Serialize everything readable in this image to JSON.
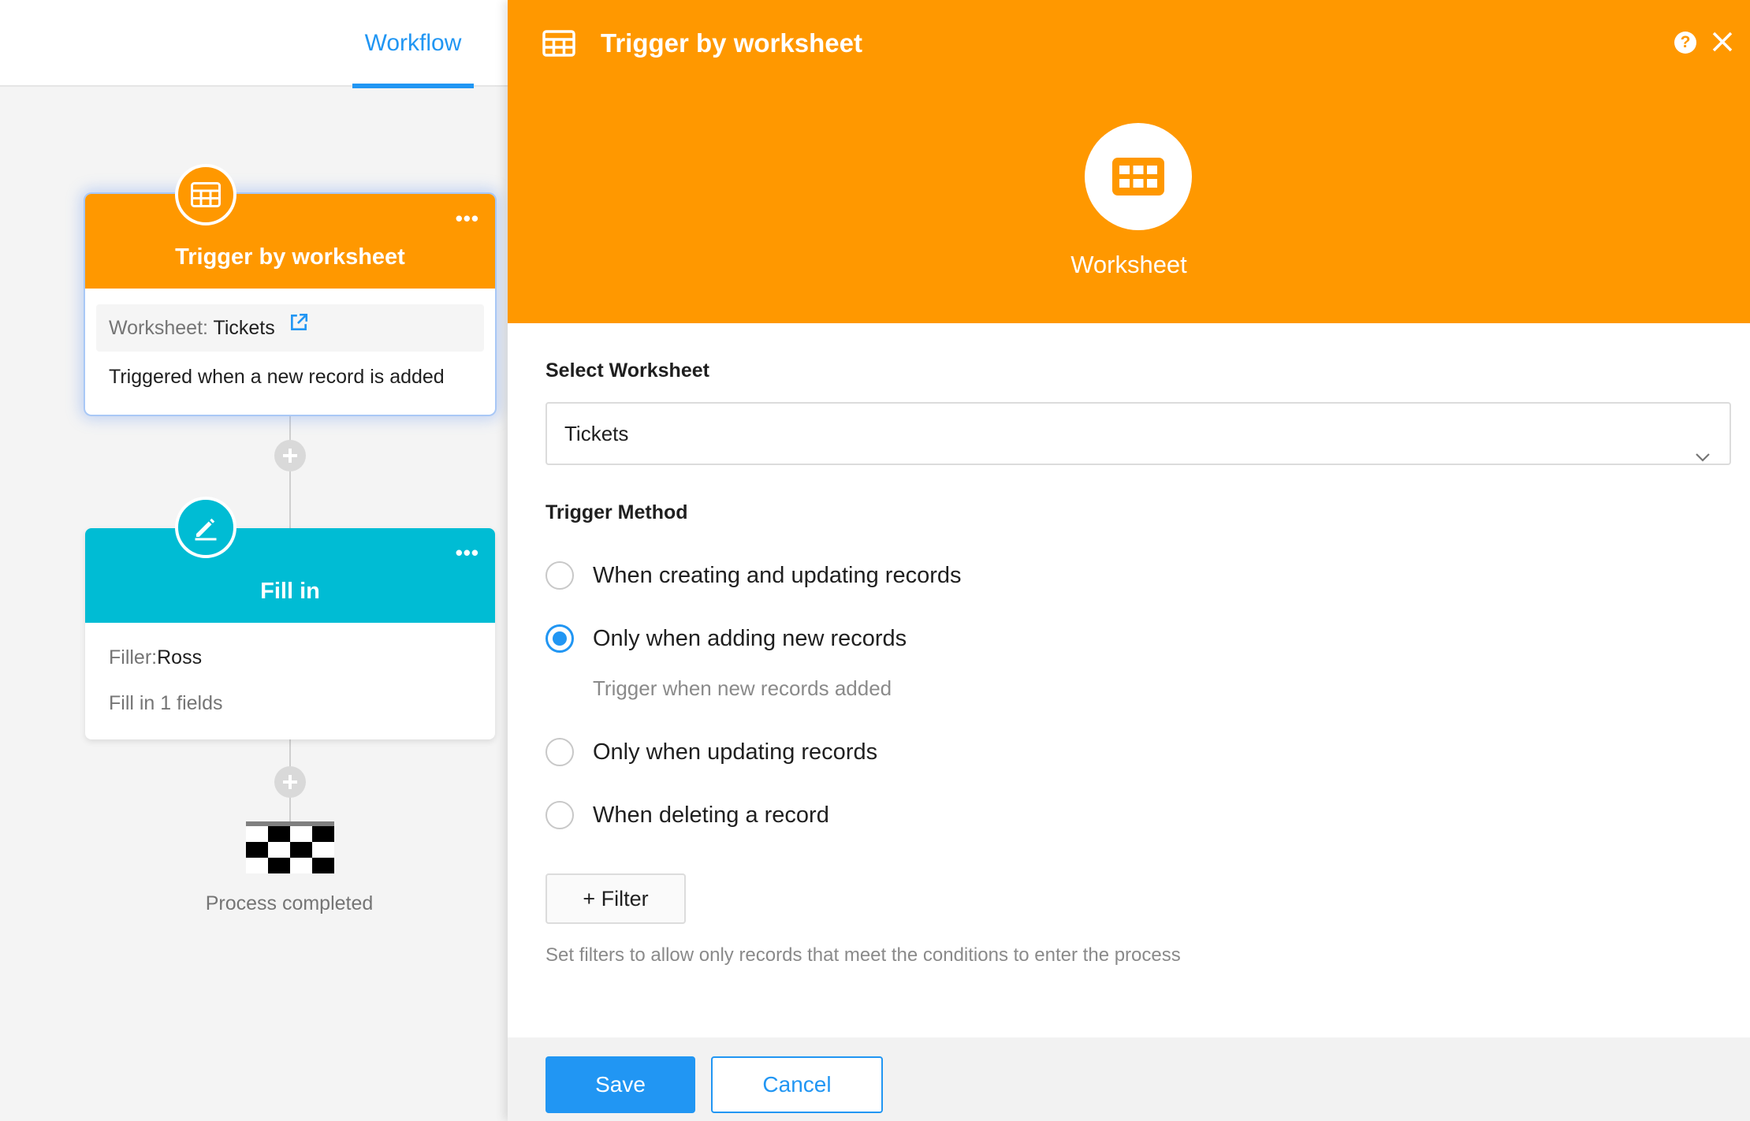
{
  "topbar": {
    "active_tab": "Workflow"
  },
  "flow": {
    "trigger_node": {
      "title": "Trigger by worksheet",
      "menu_icon": "ellipsis-icon",
      "worksheet_prefix": "Worksheet: ",
      "worksheet_value": "Tickets",
      "description": "Triggered when a new record is added",
      "color": "#ff9800"
    },
    "fill_node": {
      "title": "Fill in",
      "filler_prefix": "Filler:",
      "filler_value": "Ross",
      "fields_text": "Fill in 1 fields",
      "color": "#00bcd4"
    },
    "end": {
      "label": "Process completed"
    }
  },
  "panel": {
    "title": "Trigger by worksheet",
    "help_label": "?",
    "header_label": "Worksheet",
    "select_worksheet_label": "Select Worksheet",
    "select_worksheet_value": "Tickets",
    "trigger_method_label": "Trigger Method",
    "trigger_options": [
      {
        "label": "When creating and updating records",
        "checked": false
      },
      {
        "label": "Only when adding new records",
        "checked": true
      },
      {
        "label": "Only when updating records",
        "checked": false
      },
      {
        "label": "When deleting a record",
        "checked": false
      }
    ],
    "selected_hint": "Trigger when new records added",
    "filter_label": "+ Filter",
    "filter_hint": "Set filters to allow only records that meet the conditions to enter the process",
    "save_label": "Save",
    "cancel_label": "Cancel",
    "accent_color": "#ff9800",
    "primary_color": "#2196f3"
  }
}
